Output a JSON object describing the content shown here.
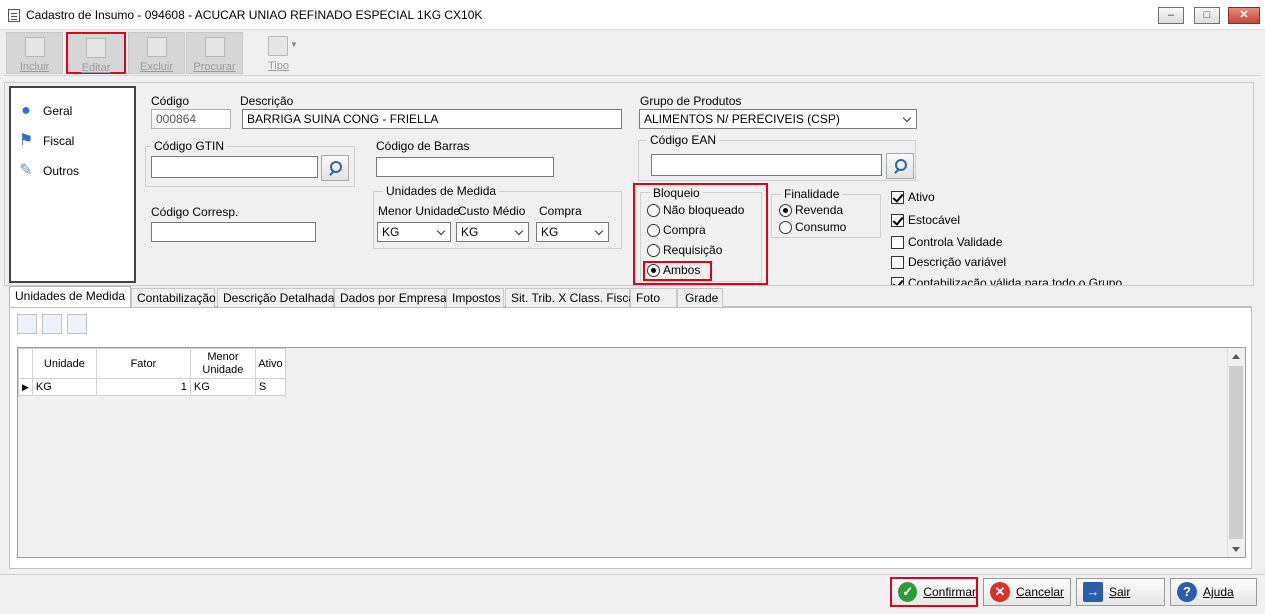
{
  "window": {
    "title": "Cadastro de Insumo - 094608 - ACUCAR UNIAO REFINADO ESPECIAL 1KG CX10K",
    "minimize_icon": "minimize-icon",
    "maximize_icon": "maximize-icon",
    "close_icon": "close-icon"
  },
  "toolbar": {
    "incluir": "Incluir",
    "editar": "Editar",
    "excluir": "Excluir",
    "procurar": "Procurar",
    "tipo": "Tipo"
  },
  "nav": {
    "items": [
      {
        "label": "Geral",
        "icon": "globe-icon"
      },
      {
        "label": "Fiscal",
        "icon": "bank-icon"
      },
      {
        "label": "Outros",
        "icon": "document-edit-icon"
      }
    ]
  },
  "form": {
    "codigo_label": "Código",
    "codigo_value": "000864",
    "descricao_label": "Descrição",
    "descricao_value": "BARRIGA SUINA CONG - FRIELLA",
    "grupo_label": "Grupo de Produtos",
    "grupo_value": "ALIMENTOS N/ PERECIVEIS  (CSP)",
    "gtin_label": "Código GTIN",
    "gtin_value": "",
    "barras_label": "Código de Barras",
    "barras_value": "",
    "ean_label": "Código EAN",
    "ean_value": "",
    "corresp_label": "Código Corresp.",
    "corresp_value": "",
    "unidades_label": "Unidades de Medida",
    "menor_unidade_label": "Menor Unidade",
    "menor_unidade_value": "KG",
    "custo_medio_label": "Custo Médio",
    "custo_medio_value": "KG",
    "compra_label": "Compra",
    "compra_value": "KG",
    "bloqueio_label": "Bloqueio",
    "bloqueio_options": [
      "Não bloqueado",
      "Compra",
      "Requisição",
      "Ambos"
    ],
    "bloqueio_selected": "Ambos",
    "finalidade_label": "Finalidade",
    "finalidade_options": [
      "Revenda",
      "Consumo"
    ],
    "finalidade_selected": "Revenda",
    "checks": [
      {
        "label": "Ativo",
        "checked": true
      },
      {
        "label": "Estocável",
        "checked": true
      },
      {
        "label": "Controla Validade",
        "checked": false
      },
      {
        "label": "Descrição variável",
        "checked": false
      },
      {
        "label": "Contabilização válida para todo o Grupo",
        "checked": true
      }
    ]
  },
  "tabs": [
    "Unidades de Medida",
    "Contabilização",
    "Descrição Detalhada",
    "Dados por Empresa",
    "Impostos",
    "Sit. Trib. X Class. Fiscal",
    "Foto",
    "Grade"
  ],
  "grid": {
    "columns": [
      "Unidade",
      "Fator",
      "Menor Unidade",
      "Ativo"
    ],
    "rows": [
      {
        "unidade": "KG",
        "fator": "1",
        "menor": "KG",
        "ativo": "S"
      }
    ]
  },
  "footer": {
    "confirmar": "Confirmar",
    "cancelar": "Cancelar",
    "sair": "Sair",
    "ajuda": "Ajuda"
  },
  "colors": {
    "highlight": "#e0001b",
    "confirm": "#2e9b3a",
    "cancel": "#d8332a",
    "help": "#2a5ea8"
  }
}
